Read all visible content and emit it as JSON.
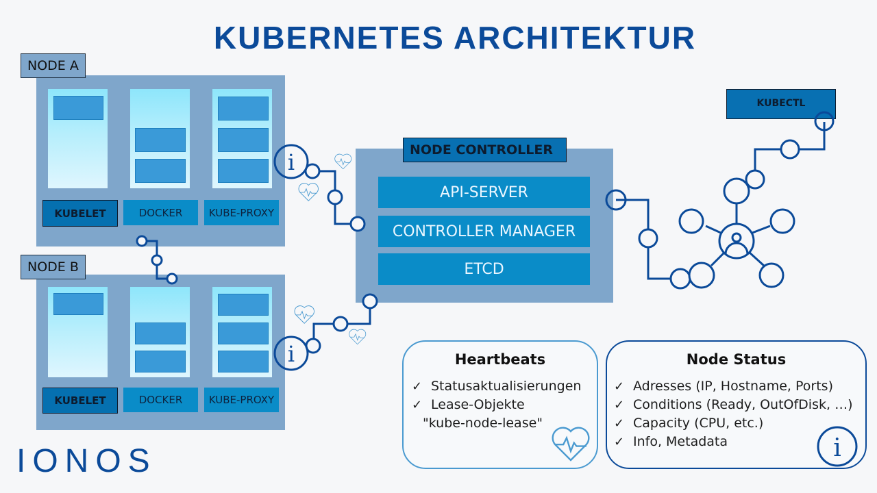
{
  "title": "KUBERNETES ARCHITEKTUR",
  "colors": {
    "brand": "#0b4a99",
    "line": "#0b4a99",
    "panel": "#7fa6cb",
    "component": "#0a8cc8",
    "kubelet": "#0570b0",
    "heart": "#4a9ad0"
  },
  "nodes": [
    {
      "label": "NODE A",
      "components": [
        "KUBELET",
        "DOCKER",
        "KUBE-PROXY"
      ]
    },
    {
      "label": "NODE B",
      "components": [
        "KUBELET",
        "DOCKER",
        "KUBE-PROXY"
      ]
    }
  ],
  "node_controller": {
    "label": "NODE CONTROLLER",
    "components": [
      "API-SERVER",
      "CONTROLLER MANAGER",
      "ETCD"
    ]
  },
  "kubectl": {
    "label": "KUBECTL"
  },
  "icons": {
    "info": "info-icon",
    "heartbeat": "heartbeat-icon",
    "user_network": "user-network-icon"
  },
  "heartbeats": {
    "title": "Heartbeats",
    "items": [
      "Statusaktualisierungen",
      "Lease-Objekte"
    ],
    "item_continuation": "\"kube-node-lease\""
  },
  "node_status": {
    "title": "Node Status",
    "items": [
      "Adresses (IP, Hostname, Ports)",
      "Conditions (Ready, OutOfDisk,  …)",
      "Capacity (CPU, etc.)",
      "Info, Metadata"
    ]
  },
  "check_glyph": "✓",
  "info_glyph": "i",
  "logo": "IONOS"
}
